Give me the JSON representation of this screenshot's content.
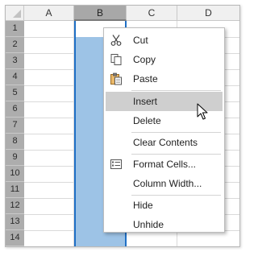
{
  "sheet": {
    "columns": [
      "A",
      "B",
      "C",
      "D"
    ],
    "selected_column": "B",
    "rows": [
      "1",
      "2",
      "3",
      "4",
      "5",
      "6",
      "7",
      "8",
      "9",
      "10",
      "11",
      "12",
      "13",
      "14"
    ]
  },
  "context_menu": {
    "items": [
      {
        "label": "Cut",
        "icon": "scissors-icon"
      },
      {
        "label": "Copy",
        "icon": "copy-icon"
      },
      {
        "label": "Paste",
        "icon": "paste-icon"
      },
      {
        "label": "Insert",
        "highlighted": true
      },
      {
        "label": "Delete"
      },
      {
        "label": "Clear Contents"
      },
      {
        "label": "Format Cells...",
        "icon": "format-cells-icon"
      },
      {
        "label": "Column Width..."
      },
      {
        "label": "Hide"
      },
      {
        "label": "Unhide"
      }
    ]
  },
  "colors": {
    "selection_fill": "#9dc3e6",
    "selection_border": "#1f6fc5",
    "menu_highlight": "#cfcfcf",
    "header_selected": "#a8a8a8"
  }
}
